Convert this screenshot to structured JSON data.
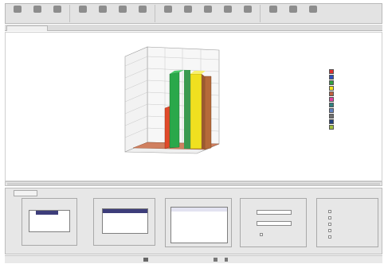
{
  "toolbar": {
    "buttons": [
      {
        "name": "new-button",
        "icon": "new-document-icon"
      },
      {
        "name": "open-button",
        "icon": "open-folder-icon"
      },
      {
        "name": "save-button",
        "icon": "save-icon"
      },
      {
        "name": "print-button",
        "icon": "print-icon"
      },
      {
        "name": "copy-button",
        "icon": "copy-icon"
      },
      {
        "name": "paste-button",
        "icon": "paste-icon"
      },
      {
        "name": "chart-type-button",
        "icon": "chart-icon"
      },
      {
        "name": "rotate-button",
        "icon": "rotate-icon"
      },
      {
        "name": "zoom-button",
        "icon": "zoom-icon"
      },
      {
        "name": "format-button",
        "icon": "format-icon"
      },
      {
        "name": "axis-button",
        "icon": "axis-icon"
      },
      {
        "name": "legend-button",
        "icon": "legend-icon"
      },
      {
        "name": "data-button",
        "icon": "data-icon"
      },
      {
        "name": "export-button",
        "icon": "export-icon"
      },
      {
        "name": "help-button",
        "icon": "help-icon"
      }
    ]
  },
  "chart": {
    "colors": {
      "red": "#e04a2a",
      "green": "#2aa84a",
      "yellow": "#f0e020",
      "brown": "#b56a3a",
      "floor": "#d08060"
    }
  },
  "legend": {
    "items": [
      {
        "color": "#e03030"
      },
      {
        "color": "#3050c0"
      },
      {
        "color": "#30a040"
      },
      {
        "color": "#f0e020"
      },
      {
        "color": "#c06040"
      },
      {
        "color": "#e040a0"
      },
      {
        "color": "#308080"
      },
      {
        "color": "#6080c0"
      },
      {
        "color": "#707070"
      },
      {
        "color": "#204080"
      },
      {
        "color": "#a0c040"
      }
    ]
  },
  "panel": {
    "colors": {
      "selection": "#3d3d7a",
      "background": "#e7e7e7"
    }
  },
  "status": {
    "colors": {
      "background": "#e9e9e9"
    }
  }
}
